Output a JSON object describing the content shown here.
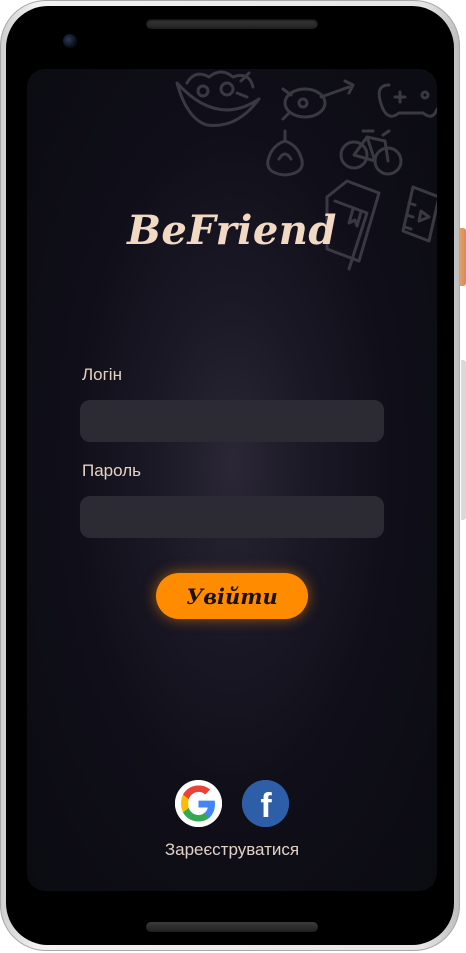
{
  "app": {
    "logo_text": "BeFriend"
  },
  "form": {
    "login_label": "Логін",
    "login_value": "",
    "password_label": "Пароль",
    "password_value": "",
    "submit_label": "Увійти"
  },
  "social": {
    "google_icon": "google-icon",
    "facebook_icon": "facebook-icon",
    "facebook_glyph": "f"
  },
  "footer": {
    "register_label": "Зареєструватися"
  },
  "colors": {
    "accent": "#ff8c00",
    "logo": "#f2d9c4",
    "background": "#100f19",
    "input_bg": "#2c2a33",
    "facebook": "#2f5ea8"
  },
  "decorations": [
    "salad-bowl-icon",
    "guitar-icon",
    "gamepad-icon",
    "onion-icon",
    "bicycle-icon",
    "book-icon",
    "film-icon"
  ]
}
